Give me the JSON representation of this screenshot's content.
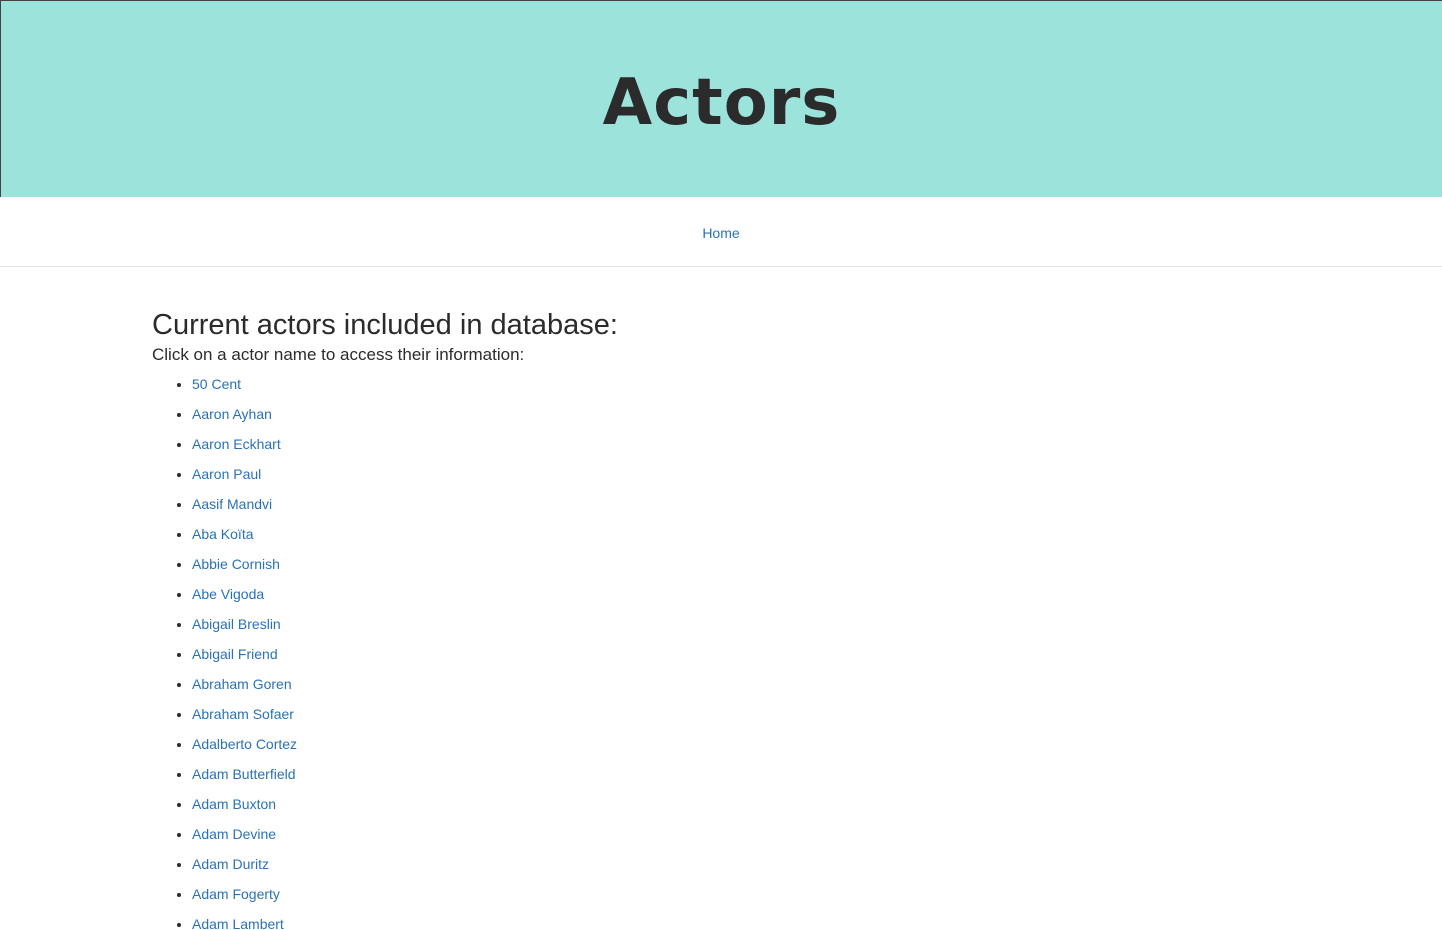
{
  "colors": {
    "accent": "#9ce3dc",
    "link": "#2a72b5"
  },
  "header": {
    "title": "Actors"
  },
  "nav": {
    "home_label": "Home"
  },
  "main": {
    "heading": "Current actors included in database:",
    "instruction": "Click on a actor name to access their information:",
    "actors": [
      "50 Cent",
      "Aaron Ayhan",
      "Aaron Eckhart",
      "Aaron Paul",
      "Aasif Mandvi",
      "Aba Koïta",
      "Abbie Cornish",
      "Abe Vigoda",
      "Abigail Breslin",
      "Abigail Friend",
      "Abraham Goren",
      "Abraham Sofaer",
      "Adalberto Cortez",
      "Adam Butterfield",
      "Adam Buxton",
      "Adam Devine",
      "Adam Duritz",
      "Adam Fogerty",
      "Adam Lambert"
    ]
  }
}
